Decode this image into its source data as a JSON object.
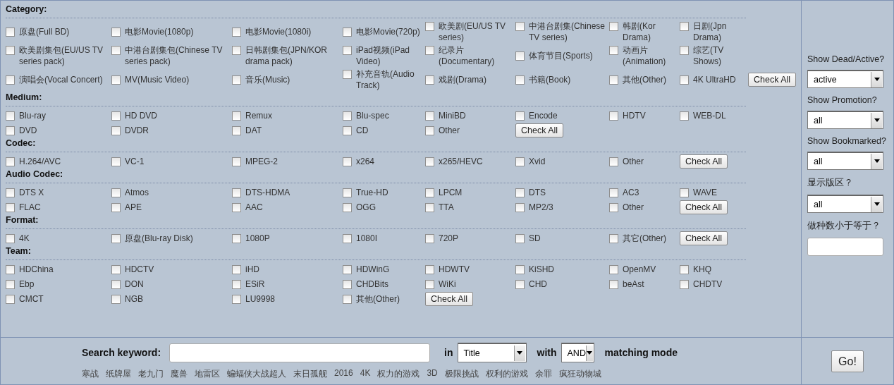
{
  "sections": [
    {
      "title": "Category:",
      "rows": [
        [
          {
            "kind": "checkbox",
            "label": "原盘(Full BD)",
            "checked": false
          },
          {
            "kind": "checkbox",
            "label": "电影Movie(1080p)",
            "checked": false
          },
          {
            "kind": "checkbox",
            "label": "电影Movie(1080i)",
            "checked": false
          },
          {
            "kind": "checkbox",
            "label": "电影Movie(720p)",
            "checked": false
          },
          {
            "kind": "checkbox",
            "label": "欧美剧(EU/US TV series)",
            "checked": false
          },
          {
            "kind": "checkbox",
            "label": "中港台剧集(Chinese TV series)",
            "checked": false
          },
          {
            "kind": "checkbox",
            "label": "韩剧(Kor Drama)",
            "checked": false
          },
          {
            "kind": "checkbox",
            "label": "日剧(Jpn Drama)",
            "checked": false
          }
        ],
        [
          {
            "kind": "checkbox",
            "label": "欧美剧集包(EU/US TV series pack)",
            "checked": false
          },
          {
            "kind": "checkbox",
            "label": "中港台剧集包(Chinese TV series pack)",
            "checked": false
          },
          {
            "kind": "checkbox",
            "label": "日韩剧集包(JPN/KOR drama pack)",
            "checked": false
          },
          {
            "kind": "checkbox",
            "label": "iPad视频(iPad Video)",
            "checked": false
          },
          {
            "kind": "checkbox",
            "label": "纪录片(Documentary)",
            "checked": false
          },
          {
            "kind": "checkbox",
            "label": "体育节目(Sports)",
            "checked": false
          },
          {
            "kind": "checkbox",
            "label": "动画片(Animation)",
            "checked": false
          },
          {
            "kind": "checkbox",
            "label": "综艺(TV Shows)",
            "checked": false
          }
        ],
        [
          {
            "kind": "checkbox",
            "label": "演唱会(Vocal Concert)",
            "checked": false
          },
          {
            "kind": "checkbox",
            "label": "MV(Music Video)",
            "checked": false
          },
          {
            "kind": "checkbox",
            "label": "音乐(Music)",
            "checked": false
          },
          {
            "kind": "checkbox",
            "label": "补充音轨(Audio Track)",
            "checked": false
          },
          {
            "kind": "checkbox",
            "label": "戏剧(Drama)",
            "checked": false
          },
          {
            "kind": "checkbox",
            "label": "书籍(Book)",
            "checked": false
          },
          {
            "kind": "checkbox",
            "label": "其他(Other)",
            "checked": false
          },
          {
            "kind": "checkbox",
            "label": "4K UltraHD",
            "checked": false
          },
          {
            "kind": "button",
            "label": "Check All"
          }
        ]
      ]
    },
    {
      "title": "Medium:",
      "rows": [
        [
          {
            "kind": "checkbox",
            "label": "Blu-ray",
            "checked": false
          },
          {
            "kind": "checkbox",
            "label": "HD DVD",
            "checked": false
          },
          {
            "kind": "checkbox",
            "label": "Remux",
            "checked": false
          },
          {
            "kind": "checkbox",
            "label": "Blu-spec",
            "checked": false
          },
          {
            "kind": "checkbox",
            "label": "MiniBD",
            "checked": false
          },
          {
            "kind": "checkbox",
            "label": "Encode",
            "checked": false
          },
          {
            "kind": "checkbox",
            "label": "HDTV",
            "checked": false
          },
          {
            "kind": "checkbox",
            "label": "WEB-DL",
            "checked": false
          }
        ],
        [
          {
            "kind": "checkbox",
            "label": "DVD",
            "checked": false
          },
          {
            "kind": "checkbox",
            "label": "DVDR",
            "checked": false
          },
          {
            "kind": "checkbox",
            "label": "DAT",
            "checked": false
          },
          {
            "kind": "checkbox",
            "label": "CD",
            "checked": false
          },
          {
            "kind": "checkbox",
            "label": "Other",
            "checked": false
          },
          {
            "kind": "button",
            "label": "Check All"
          }
        ]
      ]
    },
    {
      "title": "Codec:",
      "rows": [
        [
          {
            "kind": "checkbox",
            "label": "H.264/AVC",
            "checked": false
          },
          {
            "kind": "checkbox",
            "label": "VC-1",
            "checked": false
          },
          {
            "kind": "checkbox",
            "label": "MPEG-2",
            "checked": false
          },
          {
            "kind": "checkbox",
            "label": "x264",
            "checked": false
          },
          {
            "kind": "checkbox",
            "label": "x265/HEVC",
            "checked": false
          },
          {
            "kind": "checkbox",
            "label": "Xvid",
            "checked": false
          },
          {
            "kind": "checkbox",
            "label": "Other",
            "checked": false
          },
          {
            "kind": "button",
            "label": "Check All"
          }
        ]
      ]
    },
    {
      "title": "Audio Codec:",
      "rows": [
        [
          {
            "kind": "checkbox",
            "label": "DTS X",
            "checked": false
          },
          {
            "kind": "checkbox",
            "label": "Atmos",
            "checked": false
          },
          {
            "kind": "checkbox",
            "label": "DTS-HDMA",
            "checked": false
          },
          {
            "kind": "checkbox",
            "label": "True-HD",
            "checked": false
          },
          {
            "kind": "checkbox",
            "label": "LPCM",
            "checked": false
          },
          {
            "kind": "checkbox",
            "label": "DTS",
            "checked": false
          },
          {
            "kind": "checkbox",
            "label": "AC3",
            "checked": false
          },
          {
            "kind": "checkbox",
            "label": "WAVE",
            "checked": false
          }
        ],
        [
          {
            "kind": "checkbox",
            "label": "FLAC",
            "checked": false
          },
          {
            "kind": "checkbox",
            "label": "APE",
            "checked": false
          },
          {
            "kind": "checkbox",
            "label": "AAC",
            "checked": false
          },
          {
            "kind": "checkbox",
            "label": "OGG",
            "checked": false
          },
          {
            "kind": "checkbox",
            "label": "TTA",
            "checked": false
          },
          {
            "kind": "checkbox",
            "label": "MP2/3",
            "checked": false
          },
          {
            "kind": "checkbox",
            "label": "Other",
            "checked": false
          },
          {
            "kind": "button",
            "label": "Check All"
          }
        ]
      ]
    },
    {
      "title": "Format:",
      "rows": [
        [
          {
            "kind": "checkbox",
            "label": "4K",
            "checked": false
          },
          {
            "kind": "checkbox",
            "label": "原盘(Blu-ray Disk)",
            "checked": false
          },
          {
            "kind": "checkbox",
            "label": "1080P",
            "checked": false
          },
          {
            "kind": "checkbox",
            "label": "1080I",
            "checked": false
          },
          {
            "kind": "checkbox",
            "label": "720P",
            "checked": false
          },
          {
            "kind": "checkbox",
            "label": "SD",
            "checked": false
          },
          {
            "kind": "checkbox",
            "label": "其它(Other)",
            "checked": false
          },
          {
            "kind": "button",
            "label": "Check All"
          }
        ]
      ]
    },
    {
      "title": "Team:",
      "rows": [
        [
          {
            "kind": "checkbox",
            "label": "HDChina",
            "checked": false
          },
          {
            "kind": "checkbox",
            "label": "HDCTV",
            "checked": false
          },
          {
            "kind": "checkbox",
            "label": "iHD",
            "checked": false
          },
          {
            "kind": "checkbox",
            "label": "HDWinG",
            "checked": false
          },
          {
            "kind": "checkbox",
            "label": "HDWTV",
            "checked": false
          },
          {
            "kind": "checkbox",
            "label": "KiSHD",
            "checked": false
          },
          {
            "kind": "checkbox",
            "label": "OpenMV",
            "checked": false
          },
          {
            "kind": "checkbox",
            "label": "KHQ",
            "checked": false
          }
        ],
        [
          {
            "kind": "checkbox",
            "label": "Ebp",
            "checked": false
          },
          {
            "kind": "checkbox",
            "label": "DON",
            "checked": false
          },
          {
            "kind": "checkbox",
            "label": "ESiR",
            "checked": false
          },
          {
            "kind": "checkbox",
            "label": "CHDBits",
            "checked": false
          },
          {
            "kind": "checkbox",
            "label": "WiKi",
            "checked": false
          },
          {
            "kind": "checkbox",
            "label": "CHD",
            "checked": false
          },
          {
            "kind": "checkbox",
            "label": "beAst",
            "checked": false
          },
          {
            "kind": "checkbox",
            "label": "CHDTV",
            "checked": false
          }
        ],
        [
          {
            "kind": "checkbox",
            "label": "CMCT",
            "checked": false
          },
          {
            "kind": "checkbox",
            "label": "NGB",
            "checked": false
          },
          {
            "kind": "checkbox",
            "label": "LU9998",
            "checked": false
          },
          {
            "kind": "checkbox",
            "label": "其他(Other)",
            "checked": false
          },
          {
            "kind": "button",
            "label": "Check All"
          }
        ]
      ]
    }
  ],
  "sidebar": [
    {
      "kind": "select",
      "label": "Show Dead/Active?",
      "value": "active"
    },
    {
      "kind": "select",
      "label": "Show Promotion?",
      "value": "all"
    },
    {
      "kind": "select",
      "label": "Show Bookmarked?",
      "value": "all"
    },
    {
      "kind": "select",
      "label": "显示版区？",
      "value": "all"
    },
    {
      "kind": "input",
      "label": "做种数小于等于？"
    }
  ],
  "search": {
    "label": "Search keyword:",
    "in_label": "in",
    "in_value": "Title",
    "with_label": "with",
    "with_value": "AND",
    "mode_label": "matching mode",
    "hot_keywords": [
      "寒战",
      "纸牌屋",
      "老九门",
      "魔兽",
      "地雷区",
      "蝙蝠侠大战超人",
      "末日孤舰",
      "2016",
      "4K",
      "权力的游戏",
      "3D",
      "极限挑战",
      "权利的游戏",
      "余罪",
      "疯狂动物城"
    ]
  },
  "go_button": "Go!"
}
